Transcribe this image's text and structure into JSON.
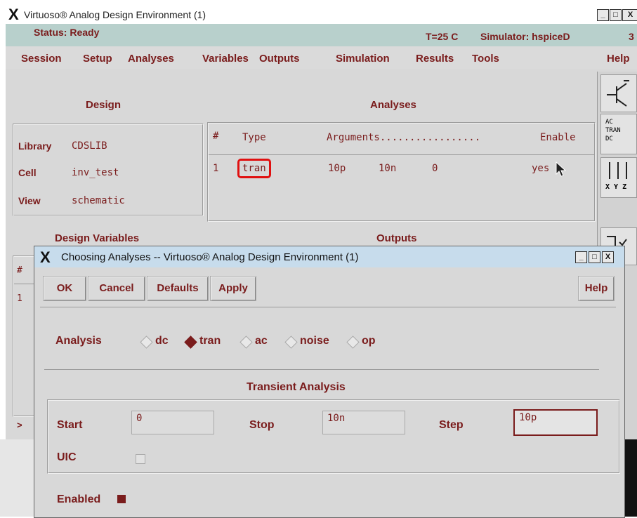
{
  "main": {
    "title": "Virtuoso® Analog Design Environment (1)",
    "status": "Status: Ready",
    "temperature": "T=25 C",
    "simulator": "Simulator: hspiceD",
    "status_extra": "3",
    "menus": [
      "Session",
      "Setup",
      "Analyses",
      "Variables",
      "Outputs",
      "Simulation",
      "Results",
      "Tools",
      "Help"
    ],
    "design": {
      "title": "Design",
      "library_label": "Library",
      "library": "CDSLIB",
      "cell_label": "Cell",
      "cell": "inv_test",
      "view_label": "View",
      "view": "schematic"
    },
    "analyses": {
      "title": "Analyses",
      "headers": [
        "#",
        "Type",
        "Arguments.................",
        "Enable"
      ],
      "row": {
        "num": "1",
        "type": "tran",
        "args": [
          "10p",
          "10n",
          "0"
        ],
        "enable": "yes"
      }
    },
    "design_variables_title": "Design Variables",
    "outputs_title": "Outputs",
    "left_table": {
      "hash": "#",
      "num": "1",
      "arrow": ">"
    },
    "toolbar": {
      "ac": "AC",
      "tran": "TRAN",
      "dc": "DC",
      "xyz": "X Y Z"
    }
  },
  "dialog": {
    "title": "Choosing Analyses -- Virtuoso® Analog Design Environment (1)",
    "buttons": {
      "ok": "OK",
      "cancel": "Cancel",
      "defaults": "Defaults",
      "apply": "Apply",
      "help": "Help"
    },
    "analysis_label": "Analysis",
    "options": [
      "dc",
      "tran",
      "ac",
      "noise",
      "op"
    ],
    "selected": "tran",
    "section_title": "Transient Analysis",
    "start_label": "Start",
    "start_value": "0",
    "stop_label": "Stop",
    "stop_value": "10n",
    "step_label": "Step",
    "step_value": "10p",
    "uic_label": "UIC",
    "enabled_label": "Enabled"
  },
  "colors": {
    "accent": "#7a1c1c",
    "highlight": "#e01010",
    "status_bg": "#b8d0cc"
  }
}
